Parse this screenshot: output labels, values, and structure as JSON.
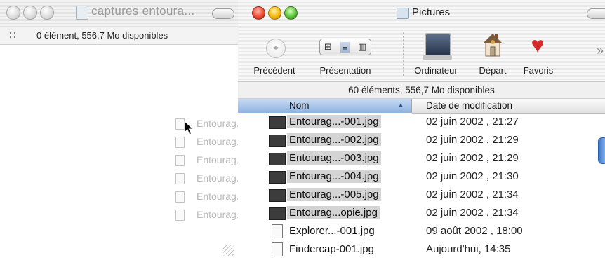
{
  "left_window": {
    "title": "captures entoura...",
    "status": "0 élément, 556,7 Mo disponibles",
    "ghost_items": [
      "Entourag...-",
      "Entourag...-",
      "Entourag...-",
      "Entourag...-",
      "Entourag...-",
      "Entourag...o"
    ]
  },
  "right_window": {
    "title": "Pictures",
    "toolbar": {
      "back_label": "Précédent",
      "view_label": "Présentation",
      "computer_label": "Ordinateur",
      "home_label": "Départ",
      "favorites_label": "Favoris"
    },
    "status": "60 éléments, 556,7 Mo disponibles",
    "columns": {
      "name": "Nom",
      "date": "Date de modification"
    },
    "files": [
      {
        "name": "Entourag...-001.jpg",
        "date": "02 juin 2002 , 21:27",
        "selected": true,
        "icon": "image-dark"
      },
      {
        "name": "Entourag...-002.jpg",
        "date": "02 juin 2002 , 21:29",
        "selected": true,
        "icon": "image-dark"
      },
      {
        "name": "Entourag...-003.jpg",
        "date": "02 juin 2002 , 21:29",
        "selected": true,
        "icon": "image-dark"
      },
      {
        "name": "Entourag...-004.jpg",
        "date": "02 juin 2002 , 21:30",
        "selected": true,
        "icon": "image-dark"
      },
      {
        "name": "Entourag...-005.jpg",
        "date": "02 juin 2002 , 21:34",
        "selected": true,
        "icon": "image-dark"
      },
      {
        "name": "Entourag...opie.jpg",
        "date": "02 juin 2002 , 21:34",
        "selected": true,
        "icon": "image-dark"
      },
      {
        "name": "Explorer...-001.jpg",
        "date": "09 août 2002 , 18:00",
        "selected": false,
        "icon": "document"
      },
      {
        "name": "Findercap-001.jpg",
        "date": "Aujourd'hui, 14:35",
        "selected": false,
        "icon": "document"
      }
    ]
  },
  "colors": {
    "selection_header": "#8fb2e0",
    "selected_row": "#d4d4d4"
  }
}
